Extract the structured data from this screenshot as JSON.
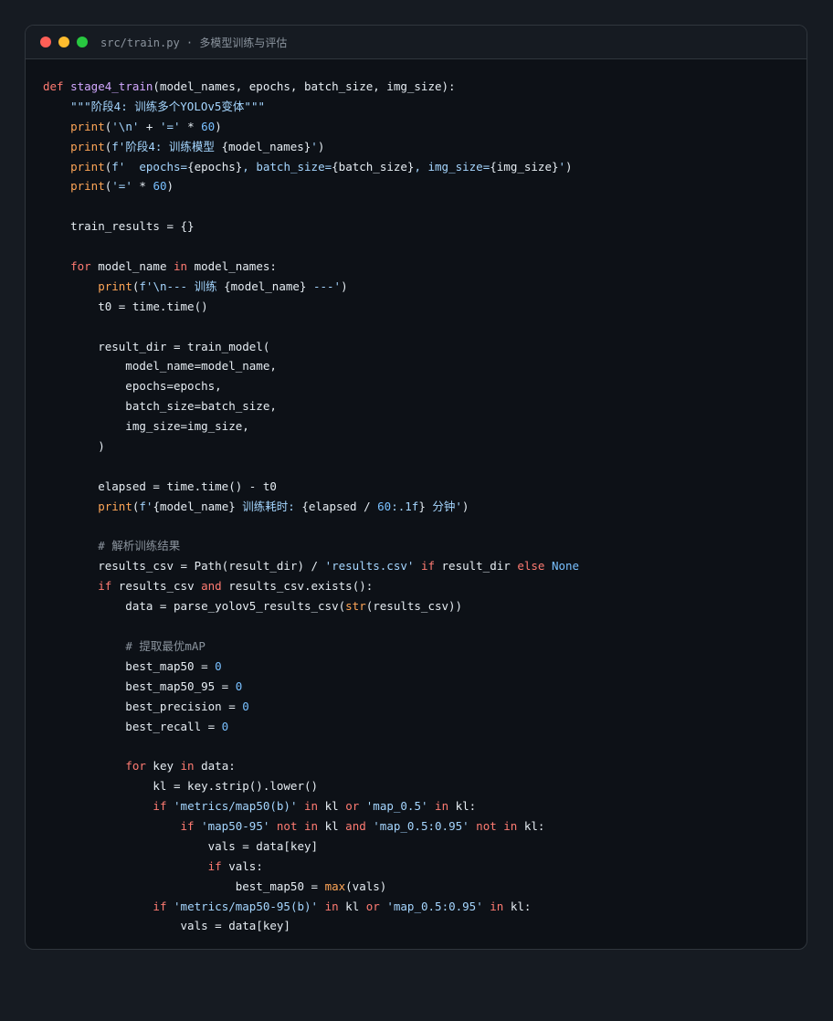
{
  "window": {
    "title": "src/train.py · 多模型训练与评估",
    "controls": [
      "close",
      "minimize",
      "maximize"
    ]
  },
  "colors": {
    "background": "#161b22",
    "editor_bg": "#0d1117",
    "keyword": "#ff7b72",
    "function": "#d2a8ff",
    "string": "#a5d6ff",
    "number": "#79c0ff",
    "builtin": "#ffa657",
    "comment": "#8b949e",
    "text": "#e6edf3"
  },
  "code_lines": [
    [
      [
        "kw",
        "def"
      ],
      [
        "pl",
        " "
      ],
      [
        "fn",
        "stage4_train"
      ],
      [
        "pl",
        "(model_names, epochs, batch_size, img_size):"
      ]
    ],
    [
      [
        "pl",
        "    "
      ],
      [
        "str",
        "\"\"\"阶段4: 训练多个YOLOv5变体\"\"\""
      ]
    ],
    [
      [
        "pl",
        "    "
      ],
      [
        "bi",
        "print"
      ],
      [
        "pl",
        "("
      ],
      [
        "str",
        "'\\n'"
      ],
      [
        "pl",
        " + "
      ],
      [
        "str",
        "'='"
      ],
      [
        "pl",
        " * "
      ],
      [
        "num",
        "60"
      ],
      [
        "pl",
        ")"
      ]
    ],
    [
      [
        "pl",
        "    "
      ],
      [
        "bi",
        "print"
      ],
      [
        "pl",
        "("
      ],
      [
        "str",
        "f'阶段4: 训练模型 "
      ],
      [
        "pl",
        "{model_names}"
      ],
      [
        "str",
        "'"
      ],
      [
        "pl",
        ")"
      ]
    ],
    [
      [
        "pl",
        "    "
      ],
      [
        "bi",
        "print"
      ],
      [
        "pl",
        "("
      ],
      [
        "str",
        "f'  epochs="
      ],
      [
        "pl",
        "{epochs}"
      ],
      [
        "str",
        ", batch_size="
      ],
      [
        "pl",
        "{batch_size}"
      ],
      [
        "str",
        ", img_size="
      ],
      [
        "pl",
        "{img_size}"
      ],
      [
        "str",
        "'"
      ],
      [
        "pl",
        ")"
      ]
    ],
    [
      [
        "pl",
        "    "
      ],
      [
        "bi",
        "print"
      ],
      [
        "pl",
        "("
      ],
      [
        "str",
        "'='"
      ],
      [
        "pl",
        " * "
      ],
      [
        "num",
        "60"
      ],
      [
        "pl",
        ")"
      ]
    ],
    [],
    [
      [
        "pl",
        "    train_results = {}"
      ]
    ],
    [],
    [
      [
        "pl",
        "    "
      ],
      [
        "kw",
        "for"
      ],
      [
        "pl",
        " model_name "
      ],
      [
        "kw",
        "in"
      ],
      [
        "pl",
        " model_names:"
      ]
    ],
    [
      [
        "pl",
        "        "
      ],
      [
        "bi",
        "print"
      ],
      [
        "pl",
        "("
      ],
      [
        "str",
        "f'\\n--- 训练 "
      ],
      [
        "pl",
        "{model_name}"
      ],
      [
        "str",
        " ---'"
      ],
      [
        "pl",
        ")"
      ]
    ],
    [
      [
        "pl",
        "        t0 = time.time()"
      ]
    ],
    [],
    [
      [
        "pl",
        "        result_dir = train_model("
      ]
    ],
    [
      [
        "pl",
        "            model_name=model_name,"
      ]
    ],
    [
      [
        "pl",
        "            epochs=epochs,"
      ]
    ],
    [
      [
        "pl",
        "            batch_size=batch_size,"
      ]
    ],
    [
      [
        "pl",
        "            img_size=img_size,"
      ]
    ],
    [
      [
        "pl",
        "        )"
      ]
    ],
    [],
    [
      [
        "pl",
        "        elapsed = time.time() - t0"
      ]
    ],
    [
      [
        "pl",
        "        "
      ],
      [
        "bi",
        "print"
      ],
      [
        "pl",
        "("
      ],
      [
        "str",
        "f'"
      ],
      [
        "pl",
        "{model_name}"
      ],
      [
        "str",
        " 训练耗时: "
      ],
      [
        "pl",
        "{elapsed / "
      ],
      [
        "num",
        "60"
      ],
      [
        "str",
        ":.1f"
      ],
      [
        "pl",
        "}"
      ],
      [
        "str",
        " 分钟'"
      ],
      [
        "pl",
        ")"
      ]
    ],
    [],
    [
      [
        "pl",
        "        "
      ],
      [
        "com",
        "# 解析训练结果"
      ]
    ],
    [
      [
        "pl",
        "        results_csv = Path(result_dir) / "
      ],
      [
        "str",
        "'results.csv'"
      ],
      [
        "pl",
        " "
      ],
      [
        "kw",
        "if"
      ],
      [
        "pl",
        " result_dir "
      ],
      [
        "kw",
        "else"
      ],
      [
        "pl",
        " "
      ],
      [
        "const",
        "None"
      ]
    ],
    [
      [
        "pl",
        "        "
      ],
      [
        "kw",
        "if"
      ],
      [
        "pl",
        " results_csv "
      ],
      [
        "kw",
        "and"
      ],
      [
        "pl",
        " results_csv.exists():"
      ]
    ],
    [
      [
        "pl",
        "            data = parse_yolov5_results_csv("
      ],
      [
        "bi",
        "str"
      ],
      [
        "pl",
        "(results_csv))"
      ]
    ],
    [],
    [
      [
        "pl",
        "            "
      ],
      [
        "com",
        "# 提取最优mAP"
      ]
    ],
    [
      [
        "pl",
        "            best_map50 = "
      ],
      [
        "num",
        "0"
      ]
    ],
    [
      [
        "pl",
        "            best_map50_95 = "
      ],
      [
        "num",
        "0"
      ]
    ],
    [
      [
        "pl",
        "            best_precision = "
      ],
      [
        "num",
        "0"
      ]
    ],
    [
      [
        "pl",
        "            best_recall = "
      ],
      [
        "num",
        "0"
      ]
    ],
    [],
    [
      [
        "pl",
        "            "
      ],
      [
        "kw",
        "for"
      ],
      [
        "pl",
        " key "
      ],
      [
        "kw",
        "in"
      ],
      [
        "pl",
        " data:"
      ]
    ],
    [
      [
        "pl",
        "                kl = key.strip().lower()"
      ]
    ],
    [
      [
        "pl",
        "                "
      ],
      [
        "kw",
        "if"
      ],
      [
        "pl",
        " "
      ],
      [
        "str",
        "'metrics/map50(b)'"
      ],
      [
        "pl",
        " "
      ],
      [
        "kw",
        "in"
      ],
      [
        "pl",
        " kl "
      ],
      [
        "kw",
        "or"
      ],
      [
        "pl",
        " "
      ],
      [
        "str",
        "'map_0.5'"
      ],
      [
        "pl",
        " "
      ],
      [
        "kw",
        "in"
      ],
      [
        "pl",
        " kl:"
      ]
    ],
    [
      [
        "pl",
        "                    "
      ],
      [
        "kw",
        "if"
      ],
      [
        "pl",
        " "
      ],
      [
        "str",
        "'map50-95'"
      ],
      [
        "pl",
        " "
      ],
      [
        "kw",
        "not in"
      ],
      [
        "pl",
        " kl "
      ],
      [
        "kw",
        "and"
      ],
      [
        "pl",
        " "
      ],
      [
        "str",
        "'map_0.5:0.95'"
      ],
      [
        "pl",
        " "
      ],
      [
        "kw",
        "not in"
      ],
      [
        "pl",
        " kl:"
      ]
    ],
    [
      [
        "pl",
        "                        vals = data[key]"
      ]
    ],
    [
      [
        "pl",
        "                        "
      ],
      [
        "kw",
        "if"
      ],
      [
        "pl",
        " vals:"
      ]
    ],
    [
      [
        "pl",
        "                            best_map50 = "
      ],
      [
        "bi",
        "max"
      ],
      [
        "pl",
        "(vals)"
      ]
    ],
    [
      [
        "pl",
        "                "
      ],
      [
        "kw",
        "if"
      ],
      [
        "pl",
        " "
      ],
      [
        "str",
        "'metrics/map50-95(b)'"
      ],
      [
        "pl",
        " "
      ],
      [
        "kw",
        "in"
      ],
      [
        "pl",
        " kl "
      ],
      [
        "kw",
        "or"
      ],
      [
        "pl",
        " "
      ],
      [
        "str",
        "'map_0.5:0.95'"
      ],
      [
        "pl",
        " "
      ],
      [
        "kw",
        "in"
      ],
      [
        "pl",
        " kl:"
      ]
    ],
    [
      [
        "pl",
        "                    vals = data[key]"
      ]
    ]
  ]
}
